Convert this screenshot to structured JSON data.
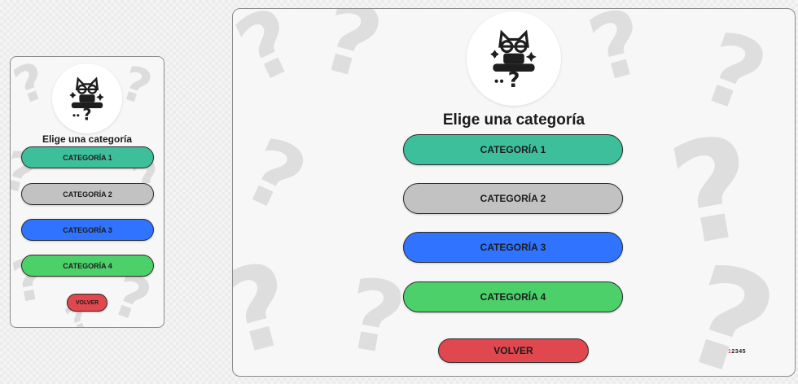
{
  "screen": {
    "heading": "Elige una categoría",
    "categories": [
      {
        "label": "CATEGORÍA 1",
        "color": "#3ebf9c"
      },
      {
        "label": "CATEGORÍA 2",
        "color": "#c2c2c2"
      },
      {
        "label": "CATEGORÍA 3",
        "color": "#2f73ff"
      },
      {
        "label": "CATEGORÍA 4",
        "color": "#4cd06a"
      }
    ],
    "back": {
      "label": "VOLVER",
      "color": "#e0474e"
    },
    "logo_icon": "detective-cat-question-icon",
    "background_icon": "question-mark-icon"
  },
  "pagination": {
    "pages": [
      "1",
      "2",
      "3",
      "4",
      "5"
    ],
    "active": "1"
  }
}
